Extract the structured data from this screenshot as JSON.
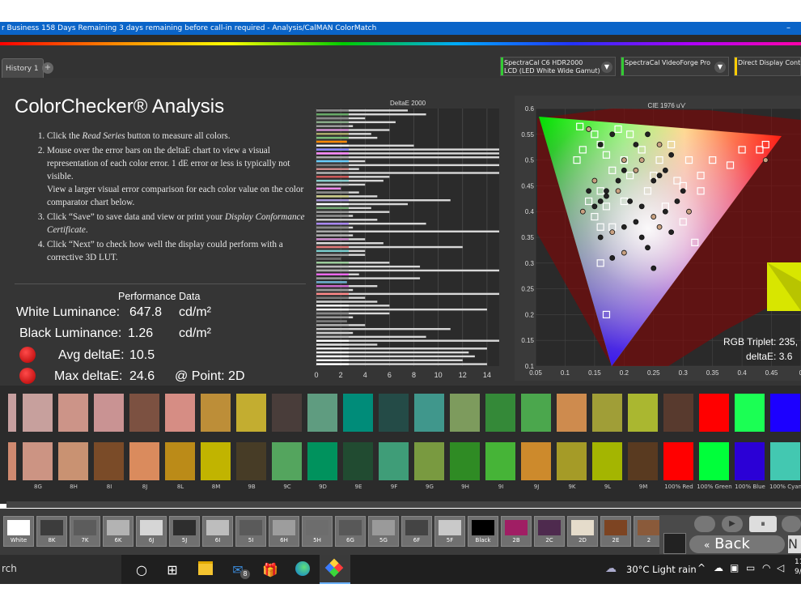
{
  "window": {
    "title": "r Business 158 Days Remaining 3 days remaining before call-in required - Analysis/CalMAN ColorMatch",
    "minimize_glyph": "–"
  },
  "tabs": [
    {
      "label": "History 1"
    }
  ],
  "add_tab_glyph": "+",
  "devices": [
    {
      "line1": "SpectraCal C6 HDR2000",
      "line2": "LCD (LED White Wide Gamut)",
      "color": "#33cc33"
    },
    {
      "line1": "SpectraCal VideoForge Pro",
      "line2": "",
      "color": "#33cc33"
    },
    {
      "line1": "Direct Display Contr",
      "line2": "",
      "color": "#ffcc00"
    }
  ],
  "page": {
    "title": "ColorChecker® Analysis",
    "instructions": [
      {
        "pre": "Click the ",
        "em": "Read Series",
        "post": " button to measure all colors.",
        "extra": ""
      },
      {
        "pre": "Mouse over the error bars on the deltaE chart to view a visual representation of each color error. 1 dE error or less is typically not visible.",
        "em": "",
        "post": "",
        "extra": "View a larger visual error comparison for each color value on the color comparator chart below."
      },
      {
        "pre": "Click “Save” to save data and view or print your ",
        "em": "Display Conformance Certificate",
        "post": ".",
        "extra": ""
      },
      {
        "pre": "Click “Next” to check how well the display could perform with a corrective 3D LUT.",
        "em": "",
        "post": "",
        "extra": ""
      }
    ]
  },
  "performance": {
    "heading": "Performance Data",
    "white_label": "White Luminance:",
    "white_value": "647.8",
    "white_unit": "cd/m²",
    "black_label": "Black Luminance:",
    "black_value": "1.26",
    "black_unit": "cd/m²",
    "avg_label": "Avg deltaE:",
    "avg_value": "10.5",
    "max_label": "Max deltaE:",
    "max_value": "24.6",
    "max_point": "@ Point: 2D"
  },
  "chart_data": [
    {
      "type": "bar",
      "title": "DeltaE 2000",
      "orientation": "horizontal",
      "xlim": [
        0,
        15
      ],
      "x_ticks": [
        "0",
        "2",
        "4",
        "6",
        "8",
        "10",
        "12",
        "14"
      ],
      "values": [
        7.5,
        9,
        4,
        6.5,
        3,
        6,
        4.5,
        5,
        2.5,
        8,
        15,
        15,
        15,
        4,
        15,
        3.5,
        15,
        6,
        5.5,
        4,
        2,
        3.5,
        5,
        11,
        7.5,
        4.5,
        6,
        3,
        5,
        9,
        3,
        15,
        3,
        4,
        5.5,
        12,
        4,
        4,
        2,
        6,
        8.5,
        15,
        3.5,
        8.5,
        2.5,
        5,
        3,
        15,
        4,
        5,
        6,
        14,
        6,
        3,
        2.5,
        4,
        11,
        3,
        9,
        15,
        5,
        14,
        12.5,
        13,
        12,
        14
      ],
      "colors": [
        "#888",
        "#6a6",
        "#888",
        "#8a8",
        "#999",
        "#c8c",
        "#aa6",
        "#7b7",
        "#f80",
        "#eee",
        "#88f",
        "#f8f",
        "#aaa",
        "#6cf",
        "#777",
        "#c88",
        "#aaa",
        "#c55",
        "#8cc",
        "#bbb",
        "#e8e",
        "#888",
        "#cc8",
        "#a9d",
        "#fff",
        "#7a7",
        "#999",
        "#888",
        "#ccc",
        "#a8f",
        "#888",
        "#aaa",
        "#aaa",
        "#c8c",
        "#ddd",
        "#d77",
        "#7cc",
        "#999",
        "#666",
        "#9c9",
        "#bbb",
        "#aaa",
        "#e6e",
        "#999",
        "#6ac",
        "#c6c",
        "#999",
        "#f88",
        "#777",
        "#ccc",
        "#fff",
        "#fff",
        "#888",
        "#999",
        "#777",
        "#aaa",
        "#ccc",
        "#ccc",
        "#bbb",
        "#fff",
        "#ddd",
        "#eee",
        "#eee",
        "#fff",
        "#fff",
        "#fff"
      ]
    },
    {
      "type": "scatter",
      "title": "CIE 1976 u'v'",
      "xlim": [
        0.05,
        0.5
      ],
      "ylim": [
        0.1,
        0.6
      ],
      "x_ticks": [
        "0.05",
        "0.1",
        "0.15",
        "0.2",
        "0.25",
        "0.3",
        "0.35",
        "0.4",
        "0.45",
        "0"
      ],
      "y_ticks": [
        "0.1",
        "0.15",
        "0.2",
        "0.25",
        "0.3",
        "0.35",
        "0.4",
        "0.45",
        "0.5",
        "0.55",
        "0.6"
      ],
      "targets": [
        [
          0.125,
          0.565
        ],
        [
          0.13,
          0.52
        ],
        [
          0.15,
          0.55
        ],
        [
          0.17,
          0.51
        ],
        [
          0.19,
          0.56
        ],
        [
          0.21,
          0.55
        ],
        [
          0.2,
          0.5
        ],
        [
          0.23,
          0.52
        ],
        [
          0.26,
          0.5
        ],
        [
          0.28,
          0.53
        ],
        [
          0.31,
          0.5
        ],
        [
          0.35,
          0.5
        ],
        [
          0.4,
          0.52
        ],
        [
          0.43,
          0.52
        ],
        [
          0.44,
          0.53
        ],
        [
          0.38,
          0.49
        ],
        [
          0.33,
          0.47
        ],
        [
          0.29,
          0.46
        ],
        [
          0.25,
          0.47
        ],
        [
          0.21,
          0.47
        ],
        [
          0.18,
          0.48
        ],
        [
          0.16,
          0.44
        ],
        [
          0.17,
          0.41
        ],
        [
          0.2,
          0.42
        ],
        [
          0.24,
          0.44
        ],
        [
          0.3,
          0.45
        ],
        [
          0.33,
          0.44
        ],
        [
          0.27,
          0.41
        ],
        [
          0.15,
          0.39
        ],
        [
          0.16,
          0.37
        ],
        [
          0.18,
          0.37
        ],
        [
          0.14,
          0.42
        ],
        [
          0.3,
          0.38
        ],
        [
          0.32,
          0.34
        ],
        [
          0.16,
          0.3
        ],
        [
          0.17,
          0.2
        ],
        [
          0.12,
          0.5
        ],
        [
          0.16,
          0.53
        ]
      ],
      "measured": [
        [
          0.14,
          0.56
        ],
        [
          0.16,
          0.53
        ],
        [
          0.18,
          0.55
        ],
        [
          0.2,
          0.5
        ],
        [
          0.22,
          0.53
        ],
        [
          0.24,
          0.55
        ],
        [
          0.26,
          0.53
        ],
        [
          0.27,
          0.48
        ],
        [
          0.25,
          0.46
        ],
        [
          0.22,
          0.48
        ],
        [
          0.19,
          0.46
        ],
        [
          0.17,
          0.44
        ],
        [
          0.15,
          0.46
        ],
        [
          0.14,
          0.44
        ],
        [
          0.16,
          0.42
        ],
        [
          0.13,
          0.4
        ],
        [
          0.15,
          0.41
        ],
        [
          0.17,
          0.43
        ],
        [
          0.19,
          0.44
        ],
        [
          0.21,
          0.42
        ],
        [
          0.23,
          0.41
        ],
        [
          0.25,
          0.39
        ],
        [
          0.27,
          0.4
        ],
        [
          0.29,
          0.42
        ],
        [
          0.31,
          0.4
        ],
        [
          0.22,
          0.38
        ],
        [
          0.2,
          0.37
        ],
        [
          0.18,
          0.36
        ],
        [
          0.16,
          0.35
        ],
        [
          0.23,
          0.35
        ],
        [
          0.26,
          0.37
        ],
        [
          0.28,
          0.36
        ],
        [
          0.24,
          0.33
        ],
        [
          0.2,
          0.32
        ],
        [
          0.18,
          0.31
        ],
        [
          0.25,
          0.29
        ],
        [
          0.44,
          0.5
        ],
        [
          0.3,
          0.44
        ],
        [
          0.2,
          0.48
        ],
        [
          0.23,
          0.5
        ],
        [
          0.26,
          0.47
        ],
        [
          0.28,
          0.51
        ]
      ],
      "annotation_rgb": "RGB Triplet: 235,",
      "annotation_de": "deltaE: 3.6"
    }
  ],
  "swatches": {
    "row1": [
      "#c7a09d",
      "#cc9488",
      "#c99393",
      "#7c5141",
      "#d68d84",
      "#bd8e38",
      "#c3ad30",
      "#493d3a",
      "#5f9c80",
      "#008c79",
      "#244b47",
      "#40978c",
      "#7d9b5d",
      "#348938",
      "#4ba74d",
      "#ce8b4e",
      "#a09e37",
      "#aab730",
      "#583a2e",
      "#ff0000",
      "#1bff54",
      "#1c00ff",
      "#00b4ff"
    ],
    "row2": [
      "#cc9483",
      "#c99272",
      "#7a4b28",
      "#da8b5d",
      "#bb8b18",
      "#c1b400",
      "#473c26",
      "#54a55e",
      "#00925d",
      "#214b31",
      "#3f9d78",
      "#799a40",
      "#2f8b24",
      "#46b437",
      "#cd8a2c",
      "#a59b27",
      "#a4b501",
      "#593a20",
      "#ff0000",
      "#00ff3a",
      "#2b00d6",
      "#43c8b1"
    ],
    "labels": [
      "8G",
      "8H",
      "8I",
      "8J",
      "8L",
      "8M",
      "9B",
      "9C",
      "9D",
      "9E",
      "9F",
      "9G",
      "9H",
      "9I",
      "9J",
      "9K",
      "9L",
      "9M",
      "100% Red",
      "100% Green",
      "100% Blue",
      "100% Cyan"
    ]
  },
  "grayscale": [
    {
      "label": "White",
      "color": "#ffffff"
    },
    {
      "label": "8K",
      "color": "#3c3c3c"
    },
    {
      "label": "7K",
      "color": "#5c5c5c"
    },
    {
      "label": "6K",
      "color": "#b3b3b3"
    },
    {
      "label": "6J",
      "color": "#d6d6d6"
    },
    {
      "label": "5J",
      "color": "#2e2e2e"
    },
    {
      "label": "6I",
      "color": "#bdbdbd"
    },
    {
      "label": "5I",
      "color": "#5a5a5a"
    },
    {
      "label": "6H",
      "color": "#9d9d9d"
    },
    {
      "label": "5H",
      "color": "#6d6d6d"
    },
    {
      "label": "6G",
      "color": "#585858"
    },
    {
      "label": "5G",
      "color": "#9a9a9a"
    },
    {
      "label": "6F",
      "color": "#444444"
    },
    {
      "label": "5F",
      "color": "#c9c9c9"
    },
    {
      "label": "Black",
      "color": "#000000"
    },
    {
      "label": "2B",
      "color": "#a01e64"
    },
    {
      "label": "2C",
      "color": "#4e2a4e"
    },
    {
      "label": "2D",
      "color": "#e5dccb"
    },
    {
      "label": "2E",
      "color": "#7d4422"
    },
    {
      "label": "2",
      "color": "#8a5a3a"
    }
  ],
  "controls": {
    "back_label": "Back",
    "next_label": "N"
  },
  "taskbar": {
    "search_text": "rch",
    "weather": "30°C  Light rain",
    "mail_badge": "8",
    "clock_line1": "11",
    "clock_line2": "9/"
  }
}
